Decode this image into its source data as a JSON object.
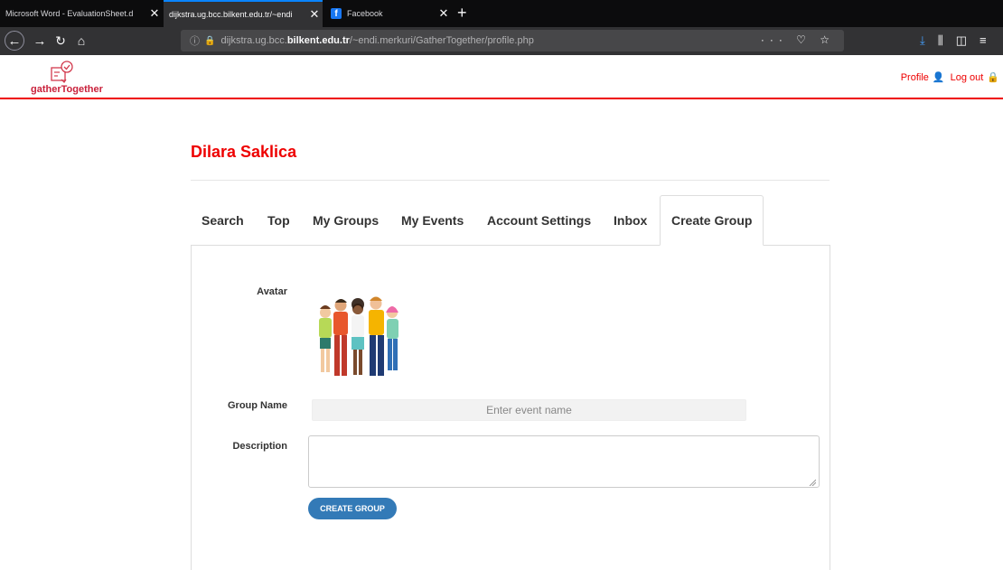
{
  "browser": {
    "tabs": [
      {
        "title": "Microsoft Word - EvaluationSheet.d",
        "close": "✕"
      },
      {
        "title": "dijkstra.ug.bcc.bilkent.edu.tr/~endi",
        "close": "✕"
      },
      {
        "title": "Facebook",
        "close": "✕"
      }
    ],
    "new_tab": "+",
    "url_prefix": "dijkstra.ug.bcc.",
    "url_host": "bilkent.edu.tr",
    "url_path": "/~endi.merkuri/GatherTogether/profile.php",
    "url_actions": "··· ♡ ☆"
  },
  "site": {
    "logo_text": "gatherTogether",
    "profile_link": "Profile",
    "logout_link": "Log out"
  },
  "profile": {
    "user_name": "Dilara Saklica",
    "tabs": [
      "Search",
      "Top",
      "My Groups",
      "My Events",
      "Account Settings",
      "Inbox",
      "Create Group"
    ],
    "active_tab": "Create Group"
  },
  "form": {
    "avatar_label": "Avatar",
    "group_name_label": "Group Name",
    "group_name_placeholder": "Enter event name",
    "description_label": "Description",
    "submit_label": "CREATE GROUP"
  },
  "colors": {
    "brand_red": "#ee0000",
    "button_blue": "#337ab7"
  }
}
